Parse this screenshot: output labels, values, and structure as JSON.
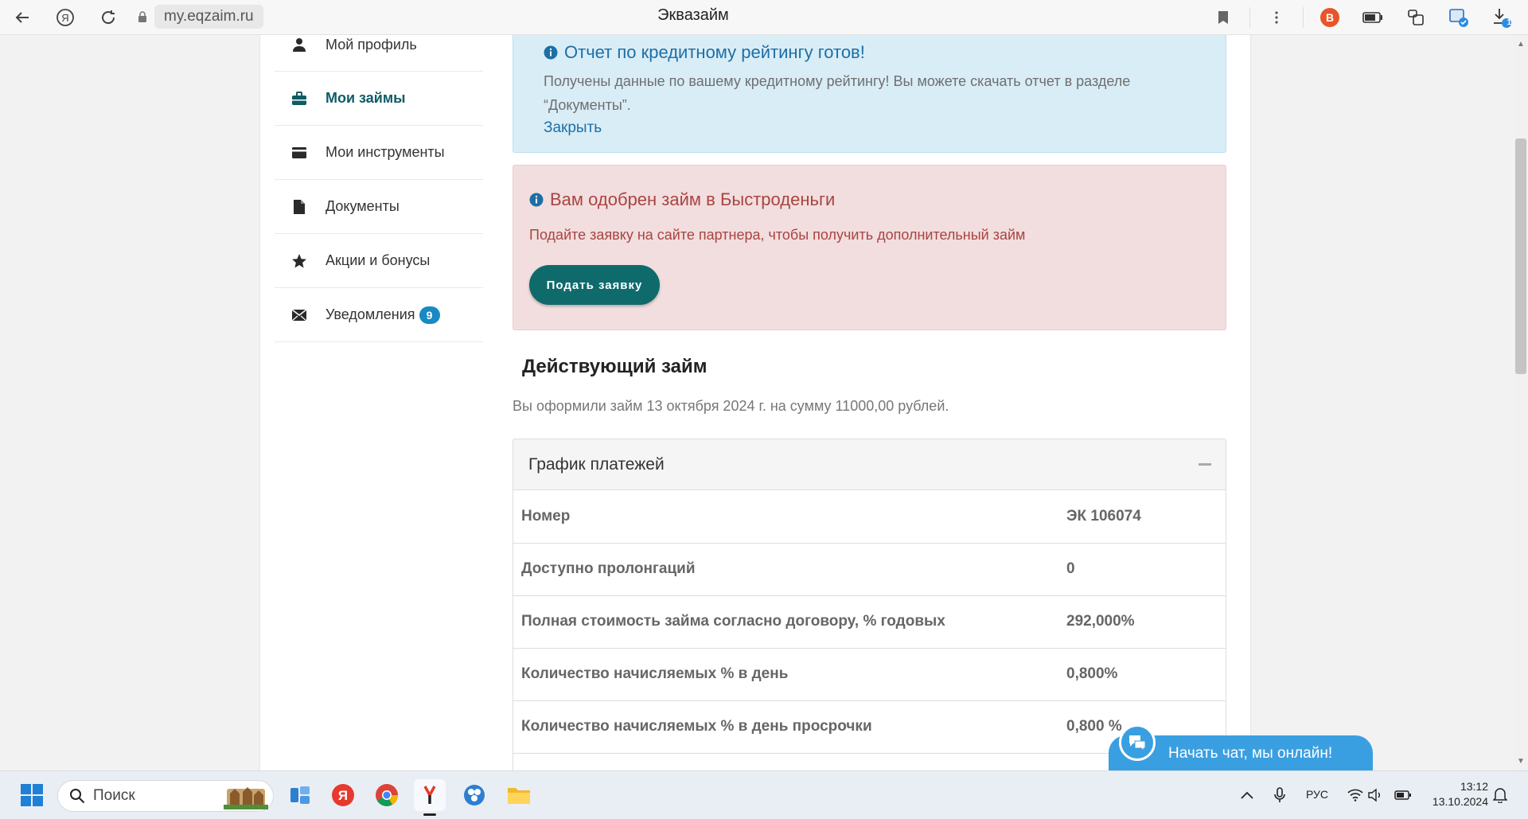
{
  "browser": {
    "url": "my.eqzaim.ru",
    "title": "Эквазайм",
    "download_count": "1"
  },
  "sidebar": {
    "items": [
      {
        "label": "Мой профиль",
        "icon": "user-icon"
      },
      {
        "label": "Мои займы",
        "icon": "briefcase-icon"
      },
      {
        "label": "Мои инструменты",
        "icon": "card-icon"
      },
      {
        "label": "Документы",
        "icon": "document-icon"
      },
      {
        "label": "Акции и бонусы",
        "icon": "star-icon"
      },
      {
        "label": "Уведомления",
        "icon": "envelope-icon",
        "badge": "9"
      }
    ]
  },
  "alerts": {
    "info": {
      "title": "Отчет по кредитному рейтингу готов!",
      "text": "Получены данные по вашему кредитному рейтингу! Вы можете скачать отчет в разделе “Документы”.",
      "close": "Закрыть"
    },
    "danger": {
      "title": "Вам одобрен займ в Быстроденьги",
      "text": "Подайте заявку на сайте партнера, чтобы получить дополнительный займ",
      "button": "Подать заявку"
    }
  },
  "loan": {
    "title": "Действующий займ",
    "subtitle": "Вы оформили займ 13 октября 2024 г. на сумму 11000,00 рублей.",
    "panel_title": "График платежей",
    "rows": [
      {
        "label": "Номер",
        "value": "ЭК 106074"
      },
      {
        "label": "Доступно пролонгаций",
        "value": "0"
      },
      {
        "label": "Полная стоимость займа согласно договору, % годовых",
        "value": "292,000%"
      },
      {
        "label": "Количество начисляемых % в день",
        "value": "0,800%"
      },
      {
        "label": "Количество начисляемых % в день просрочки",
        "value": "0,800 %"
      }
    ]
  },
  "chat": {
    "label": "Начать чат, мы онлайн!"
  },
  "taskbar": {
    "search_placeholder": "Поиск",
    "lang": "РУС",
    "time": "13:12",
    "date": "13.10.2024"
  },
  "colors": {
    "accent_teal": "#0f6a6c",
    "info_bg": "#d9edf7",
    "danger_bg": "#f2dede",
    "badge_blue": "#1989c4",
    "chat_blue": "#3a9fe0"
  }
}
